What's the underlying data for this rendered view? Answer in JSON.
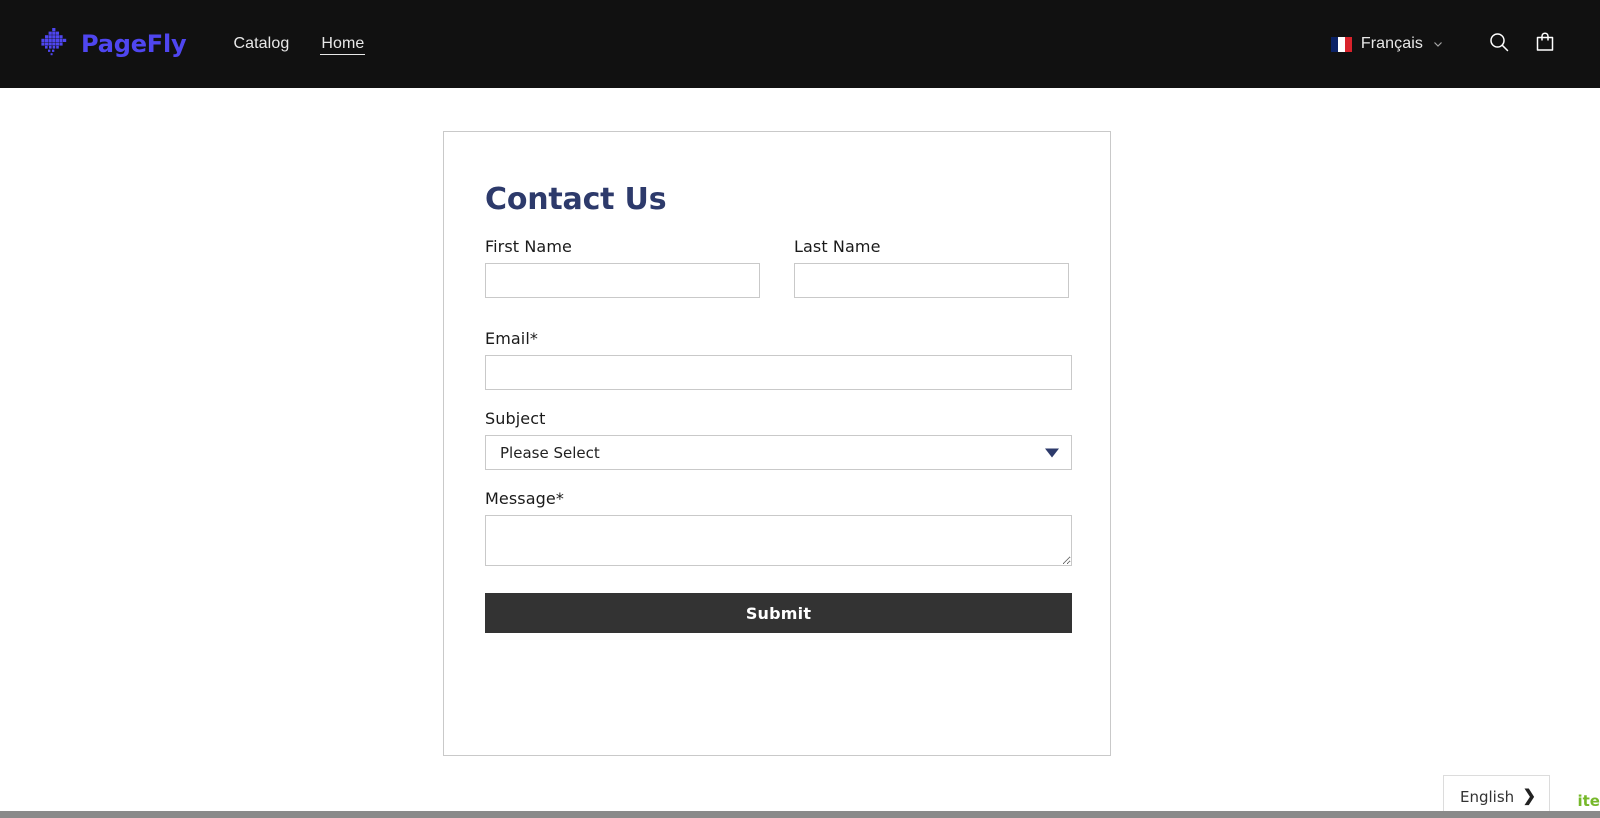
{
  "header": {
    "brand": {
      "name": "PageFly",
      "logo_icon": "pagefly-diamond-logo-icon",
      "accent_color": "#4f46f0"
    },
    "nav": [
      {
        "label": "Catalog",
        "active": false
      },
      {
        "label": "Home",
        "active": true
      }
    ],
    "language": {
      "label": "Français",
      "flag_icon": "french-flag-icon",
      "chevron_icon": "chevron-down-icon"
    },
    "search_icon": "search-icon",
    "cart_icon": "shopping-bag-icon",
    "background_color": "#111111"
  },
  "contact_form": {
    "title": "Contact Us",
    "title_color": "#2d3a6b",
    "fields": {
      "first_name": {
        "label": "First Name",
        "value": "",
        "placeholder": ""
      },
      "last_name": {
        "label": "Last Name",
        "value": "",
        "placeholder": ""
      },
      "email": {
        "label": "Email*",
        "value": "",
        "placeholder": ""
      },
      "subject": {
        "label": "Subject",
        "selected": "Please Select",
        "caret_icon": "triangle-down-icon"
      },
      "message": {
        "label": "Message*",
        "value": "",
        "placeholder": ""
      }
    },
    "submit": {
      "label": "Submit",
      "background_color": "#333333",
      "text_color": "#ffffff"
    }
  },
  "footer_widgets": {
    "language_widget": {
      "label": "English",
      "arrow_icon": "chevron-right-icon"
    },
    "site_badge": {
      "label": "ite",
      "color": "#76b82a"
    }
  }
}
